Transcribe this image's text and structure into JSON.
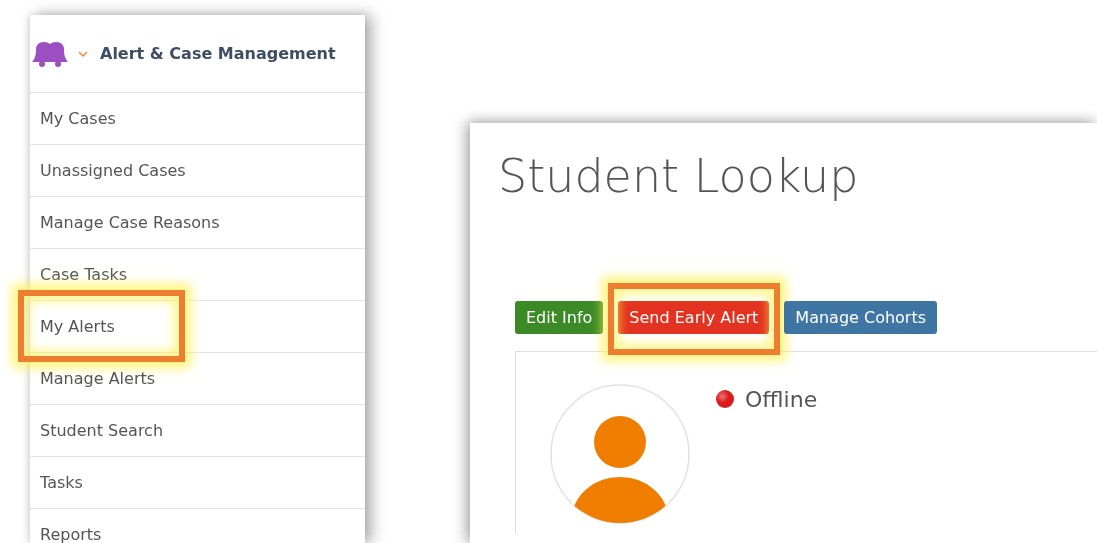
{
  "sidebar": {
    "title": "Alert & Case Management",
    "expanded": true,
    "items": [
      {
        "label": "My Cases",
        "highlighted": false
      },
      {
        "label": "Unassigned Cases",
        "highlighted": false
      },
      {
        "label": "Manage Case Reasons",
        "highlighted": false
      },
      {
        "label": "Case Tasks",
        "highlighted": false
      },
      {
        "label": "My Alerts",
        "highlighted": true
      },
      {
        "label": "Manage Alerts",
        "highlighted": false
      },
      {
        "label": "Student Search",
        "highlighted": false
      },
      {
        "label": "Tasks",
        "highlighted": false
      },
      {
        "label": "Reports",
        "highlighted": false
      }
    ]
  },
  "main": {
    "title": "Student Lookup",
    "buttons": [
      {
        "label": "Edit Info",
        "kind": "success",
        "highlighted": false
      },
      {
        "label": "Send Early Alert",
        "kind": "danger",
        "highlighted": true
      },
      {
        "label": "Manage Cohorts",
        "kind": "primary",
        "highlighted": false
      }
    ],
    "status": {
      "label": "Offline",
      "color": "#dd1a1a"
    }
  }
}
